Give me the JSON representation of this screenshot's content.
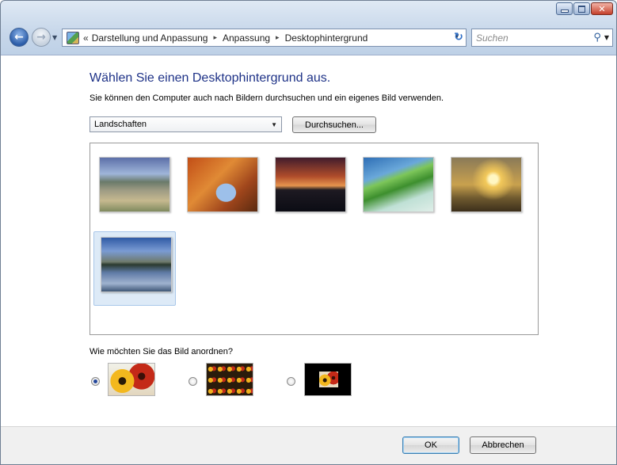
{
  "window": {
    "controls": [
      "minimize-icon",
      "maximize-icon",
      "close-icon"
    ]
  },
  "nav": {
    "back_icon": "back-arrow-icon",
    "forward_icon": "forward-arrow-icon",
    "breadcrumb_lead": "«",
    "breadcrumb": [
      "Darstellung und Anpassung",
      "Anpassung",
      "Desktophintergrund"
    ],
    "search_placeholder": "Suchen"
  },
  "main": {
    "title": "Wählen Sie einen Desktophintergrund aus.",
    "subtitle": "Sie können den Computer auch nach Bildern durchsuchen und ein eigenes Bild verwenden.",
    "location_select": "Landschaften",
    "browse_label": "Durchsuchen...",
    "images": [
      {
        "id": "mountain-lake-rice-fields",
        "selected": false
      },
      {
        "id": "rock-arch",
        "selected": false
      },
      {
        "id": "sunset-dusk",
        "selected": false
      },
      {
        "id": "palm-leaf-beach",
        "selected": false
      },
      {
        "id": "sunrise-grass",
        "selected": false
      },
      {
        "id": "mountain-lake-reflection",
        "selected": true
      }
    ],
    "arrange_label": "Wie möchten Sie das Bild anordnen?",
    "arrange_options": [
      {
        "id": "fill",
        "checked": true
      },
      {
        "id": "tile",
        "checked": false
      },
      {
        "id": "center",
        "checked": false
      }
    ]
  },
  "footer": {
    "ok_label": "OK",
    "cancel_label": "Abbrechen"
  }
}
